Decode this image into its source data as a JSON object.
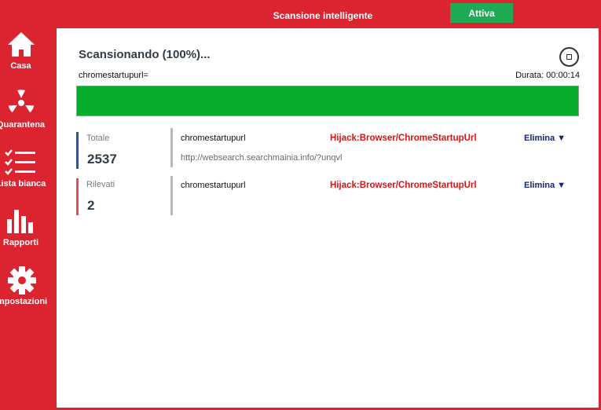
{
  "header": {
    "title": "Scansione intelligente",
    "activate_label": "Attiva"
  },
  "sidebar": {
    "items": [
      {
        "label": "Casa",
        "icon": "home-icon"
      },
      {
        "label": "Quarantena",
        "icon": "radiation-icon"
      },
      {
        "label": "Lista bianca",
        "icon": "checklist-icon"
      },
      {
        "label": "Rapporti",
        "icon": "bar-chart-icon"
      },
      {
        "label": "Impostazioni",
        "icon": "gear-icon"
      }
    ]
  },
  "scan": {
    "status": "Scansionando (100%)...",
    "current_item": "chromestartupurl=",
    "duration_label": "Durata:",
    "duration_value": "00:00:14",
    "progress": 100
  },
  "stats": {
    "total_label": "Totale",
    "total_value": "2537",
    "found_label": "Rilevati",
    "found_value": "2"
  },
  "results": [
    {
      "name": "chromestartupurl",
      "threat": "Hijack:Browser/ChromeStartupUrl",
      "action": "Elimina ▼",
      "detail": "http://websearch.searchmainia.info/?unqvl"
    },
    {
      "name": "chromestartupurl",
      "threat": "Hijack:Browser/ChromeStartupUrl",
      "action": "Elimina ▼",
      "detail": ""
    }
  ],
  "colors": {
    "brand_red": "#dc2430",
    "progress_green": "#05ad2a",
    "activate_green": "#1faa55",
    "threat_red": "#e01010",
    "action_blue": "#16237a"
  }
}
